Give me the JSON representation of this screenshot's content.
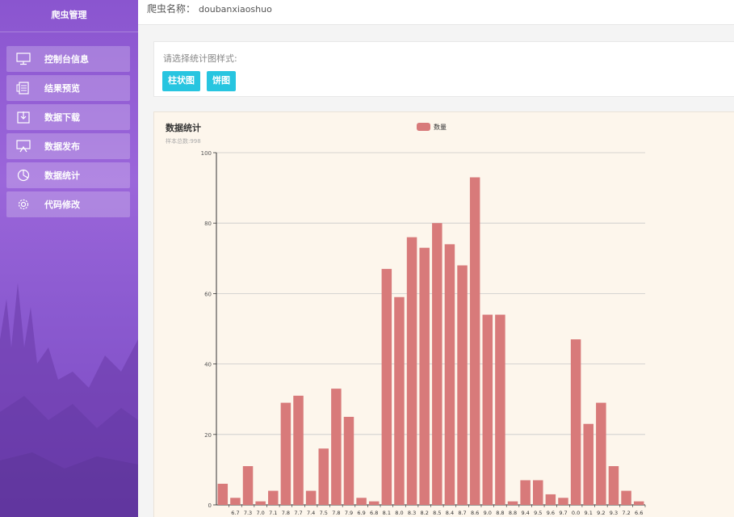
{
  "sidebar": {
    "title": "爬虫管理",
    "items": [
      {
        "label": "控制台信息",
        "icon": "monitor-icon"
      },
      {
        "label": "结果预览",
        "icon": "document-list-icon"
      },
      {
        "label": "数据下载",
        "icon": "download-icon"
      },
      {
        "label": "数据发布",
        "icon": "publish-screen-icon"
      },
      {
        "label": "数据统计",
        "icon": "pie-chart-icon"
      },
      {
        "label": "代码修改",
        "icon": "gear-icon"
      }
    ]
  },
  "header": {
    "crawler_label": "爬虫名称：",
    "crawler_name": "doubanxiaoshuo"
  },
  "chart_select": {
    "prompt": "请选择统计图样式:",
    "bar_button": "柱状图",
    "pie_button": "饼图"
  },
  "colors": {
    "accent_button": "#27c5e0",
    "bar": "#d87a7a",
    "chart_bg": "#fdf6ec"
  },
  "chart_data": {
    "type": "bar",
    "title": "数据统计",
    "subtitle": "样本总数:998",
    "legend": "数量",
    "legend_position": "top-center",
    "grid": true,
    "ylim": [
      0,
      100
    ],
    "y_ticks": [
      0,
      20,
      40,
      60,
      80,
      100
    ],
    "categories": [
      "",
      "6.7",
      "7.3",
      "7.0",
      "7.1",
      "7.8",
      "7.7",
      "7.4",
      "7.5",
      "7.8",
      "7.9",
      "6.9",
      "6.8",
      "8.1",
      "8.0",
      "8.3",
      "8.2",
      "8.5",
      "8.4",
      "8.7",
      "8.6",
      "9.0",
      "8.8",
      "8.8",
      "9.4",
      "9.5",
      "9.6",
      "9.7",
      "0.0",
      "9.1",
      "9.2",
      "9.3",
      "7.2",
      "6.6"
    ],
    "series": [
      {
        "name": "数量",
        "values": [
          6,
          2,
          11,
          1,
          4,
          29,
          31,
          4,
          16,
          33,
          25,
          2,
          1,
          67,
          59,
          76,
          73,
          80,
          74,
          68,
          93,
          54,
          54,
          1,
          7,
          7,
          3,
          2,
          47,
          23,
          29,
          11,
          4,
          1
        ]
      }
    ]
  }
}
